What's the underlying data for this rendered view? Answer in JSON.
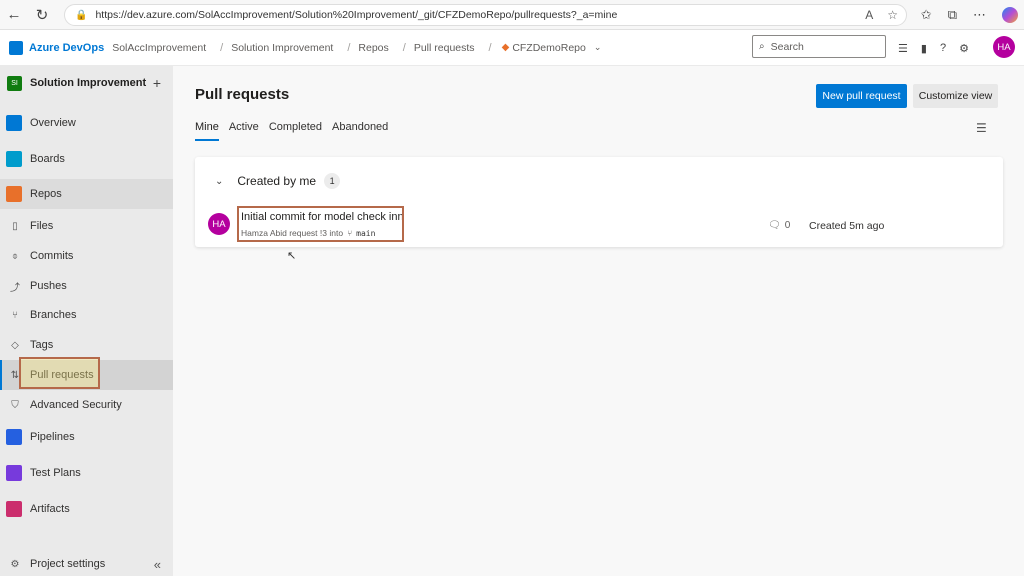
{
  "browser": {
    "url": "https://dev.azure.com/SolAccImprovement/Solution%20Improvement/_git/CFZDemoRepo/pullrequests?_a=mine"
  },
  "header": {
    "brand": "Azure DevOps",
    "breadcrumbs": [
      "SolAccImprovement",
      "Solution Improvement",
      "Repos",
      "Pull requests",
      "CFZDemoRepo"
    ],
    "search_placeholder": "Search",
    "user_initials": "HA"
  },
  "sidebar": {
    "project_badge": "SI",
    "project_name": "Solution Improvement",
    "items": [
      {
        "label": "Overview",
        "color": "#0078d4"
      },
      {
        "label": "Boards",
        "color": "#009ccc"
      },
      {
        "label": "Repos",
        "color": "#e8702a"
      },
      {
        "label": "Files"
      },
      {
        "label": "Commits"
      },
      {
        "label": "Pushes"
      },
      {
        "label": "Branches"
      },
      {
        "label": "Tags"
      },
      {
        "label": "Pull requests"
      },
      {
        "label": "Advanced Security"
      },
      {
        "label": "Pipelines",
        "color": "#2560e0"
      },
      {
        "label": "Test Plans",
        "color": "#773adc"
      },
      {
        "label": "Artifacts",
        "color": "#cb2e6d"
      }
    ],
    "settings_label": "Project settings"
  },
  "main": {
    "title": "Pull requests",
    "new_pr_label": "New pull request",
    "customize_label": "Customize view",
    "tabs": [
      "Mine",
      "Active",
      "Completed",
      "Abandoned"
    ],
    "selected_tab": "Mine",
    "group": {
      "label": "Created by me",
      "count": "1",
      "pr": {
        "author_initials": "HA",
        "title": "Initial commit for model check inn",
        "subtitle": "Hamza Abid request !3 into",
        "target_branch": "main",
        "comments": "0",
        "created": "Created 5m ago"
      }
    }
  }
}
